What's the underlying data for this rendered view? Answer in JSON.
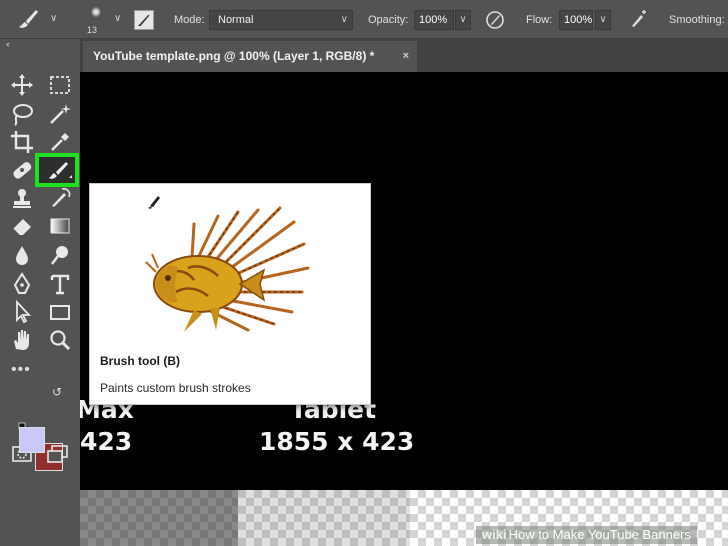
{
  "options_bar": {
    "brush_size": "13",
    "mode_label": "Mode:",
    "mode_value": "Normal",
    "opacity_label": "Opacity:",
    "opacity_value": "100%",
    "flow_label": "Flow:",
    "flow_value": "100%",
    "smoothing_label": "Smoothing:"
  },
  "document": {
    "tab_title": "YouTube template.png @ 100% (Layer 1, RGB/8) *",
    "close_glyph": "×"
  },
  "canvas": {
    "text_max": "Max",
    "text_max_value": "423",
    "text_tablet": "Tablet",
    "text_tablet_value": "1855 x 423"
  },
  "tooltip": {
    "title": "Brush tool (B)",
    "description": "Paints custom brush strokes"
  },
  "toolbar": {
    "active_tool": "brush-tool",
    "foreground_color": "#c9c8f6",
    "background_color": "#8f2f2f"
  },
  "colors": {
    "highlight": "#1ee01e",
    "canvas": "#000000",
    "ui_panel": "#535353"
  },
  "watermark": {
    "brand": "wiki",
    "text": "How to Make YouTube Banners"
  }
}
